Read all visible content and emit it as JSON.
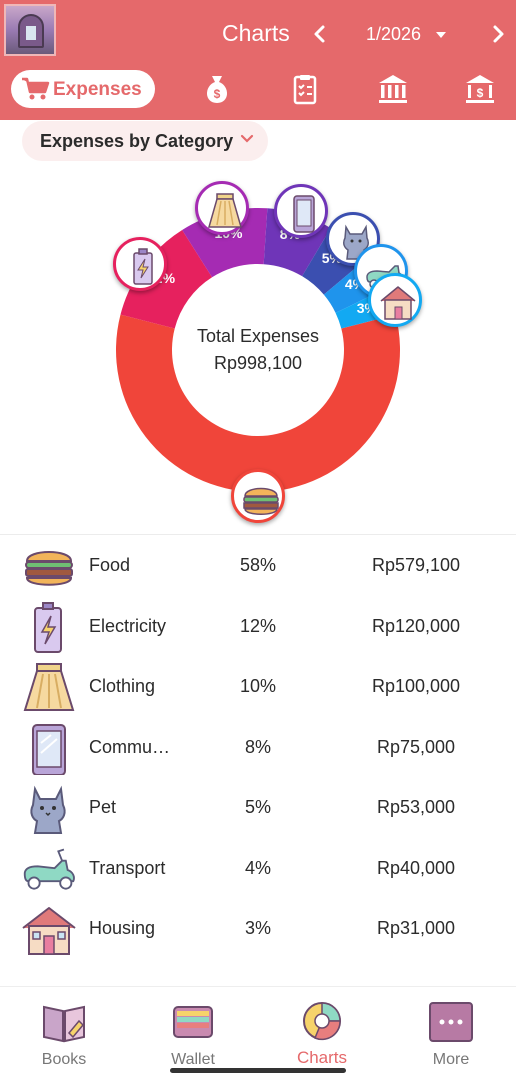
{
  "header": {
    "title": "Charts",
    "period": "1/2026",
    "prev_icon": "chevron-left-icon",
    "next_icon": "chevron-right-icon"
  },
  "tabs": [
    {
      "label": "Expenses",
      "icon": "cart-icon",
      "active": true
    },
    {
      "label": "",
      "icon": "money-bag-icon",
      "active": false
    },
    {
      "label": "",
      "icon": "clipboard-icon",
      "active": false
    },
    {
      "label": "",
      "icon": "bank-icon",
      "active": false
    },
    {
      "label": "",
      "icon": "bank-dollar-icon",
      "active": false
    }
  ],
  "selector": {
    "label": "Expenses by Category"
  },
  "chart_data": {
    "type": "pie",
    "title": "",
    "center_label": "Total Expenses",
    "center_value": "Rp998,100",
    "categories": [
      "Food",
      "Electricity",
      "Clothing",
      "Commu…",
      "Pet",
      "Transport",
      "Housing"
    ],
    "values": [
      579100,
      120000,
      100000,
      75000,
      53000,
      40000,
      31000
    ],
    "percent_labels": [
      "58%",
      "12%",
      "10%",
      "8%",
      "5%",
      "4%",
      "3%"
    ],
    "colors": [
      "#f0453a",
      "#e6215e",
      "#a52bb3",
      "#6f35b8",
      "#3b4fb0",
      "#1f94ec",
      "#12a9f2"
    ]
  },
  "list": [
    {
      "name": "Food",
      "percent": "58%",
      "amount": "Rp579,100",
      "icon": "burger-icon"
    },
    {
      "name": "Electricity",
      "percent": "12%",
      "amount": "Rp120,000",
      "icon": "battery-icon"
    },
    {
      "name": "Clothing",
      "percent": "10%",
      "amount": "Rp100,000",
      "icon": "skirt-icon"
    },
    {
      "name": "Commu…",
      "percent": "8%",
      "amount": "Rp75,000",
      "icon": "phone-icon"
    },
    {
      "name": "Pet",
      "percent": "5%",
      "amount": "Rp53,000",
      "icon": "cat-icon"
    },
    {
      "name": "Transport",
      "percent": "4%",
      "amount": "Rp40,000",
      "icon": "scooter-icon"
    },
    {
      "name": "Housing",
      "percent": "3%",
      "amount": "Rp31,000",
      "icon": "house-icon"
    }
  ],
  "bottom_nav": [
    {
      "label": "Books",
      "icon": "book-icon",
      "active": false
    },
    {
      "label": "Wallet",
      "icon": "wallet-icon",
      "active": false
    },
    {
      "label": "Charts",
      "icon": "pie-chart-icon",
      "active": true
    },
    {
      "label": "More",
      "icon": "more-icon",
      "active": false
    }
  ],
  "colors": {
    "brand": "#e5696b",
    "pill_bg": "#fbeeee"
  }
}
